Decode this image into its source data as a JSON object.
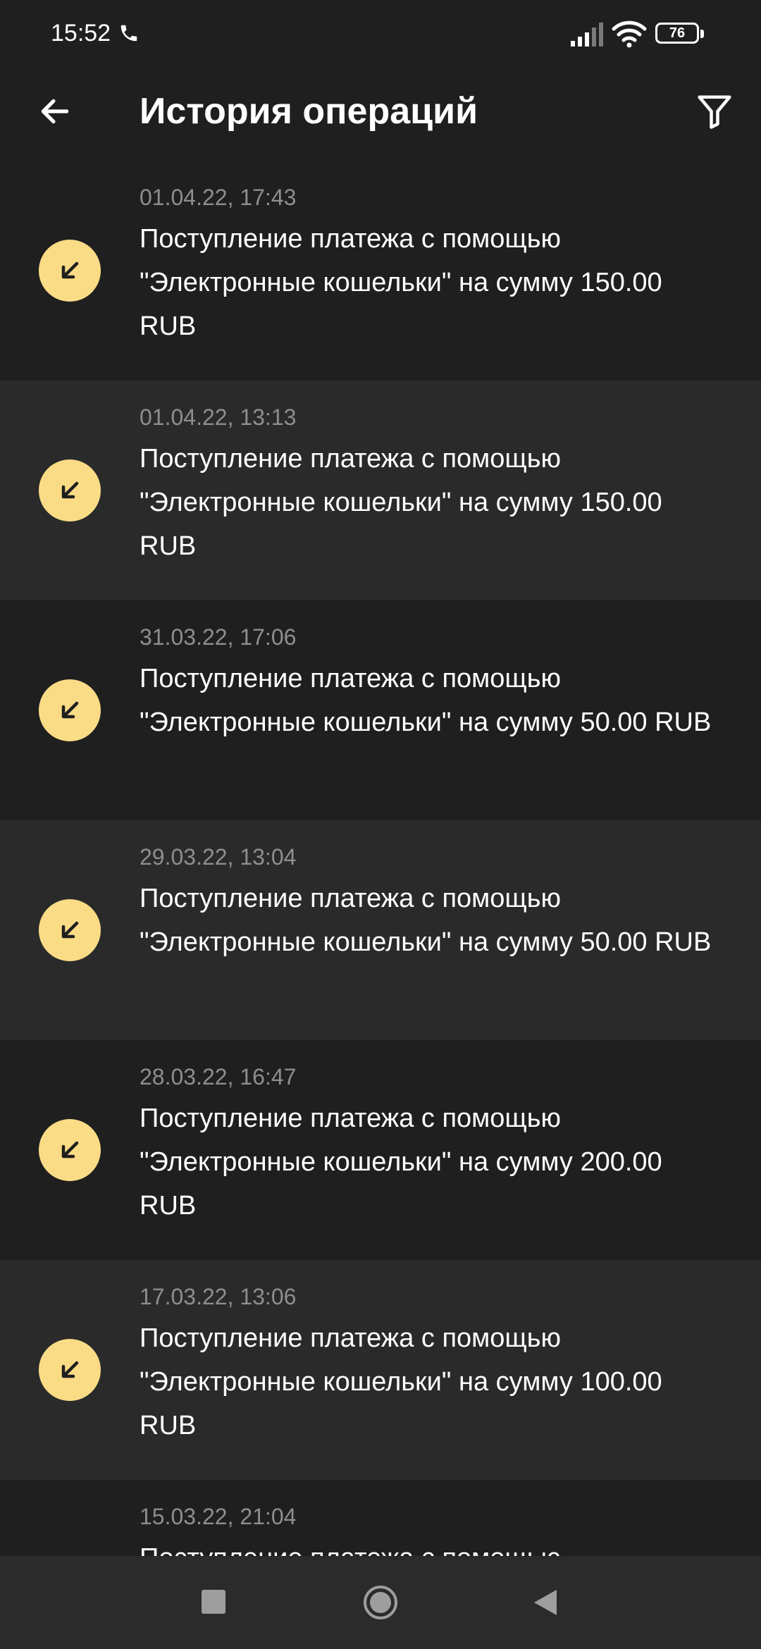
{
  "status_bar": {
    "time": "15:52",
    "battery": "76",
    "icons": [
      "phone-call-icon",
      "signal-icon",
      "wifi-icon",
      "battery-icon"
    ]
  },
  "header": {
    "title": "История операций",
    "back_icon": "arrow-left-icon",
    "filter_icon": "filter-icon"
  },
  "operations": [
    {
      "date": "01.04.22, 17:43",
      "description": "Поступление платежа с помощью \"Электронные кошельки\" на сумму 150.00 RUB"
    },
    {
      "date": "01.04.22, 13:13",
      "description": "Поступление платежа с помощью \"Электронные кошельки\" на сумму 150.00 RUB"
    },
    {
      "date": "31.03.22, 17:06",
      "description": "Поступление платежа с помощью \"Электронные кошельки\" на сумму 50.00 RUB"
    },
    {
      "date": "29.03.22, 13:04",
      "description": "Поступление платежа с помощью \"Электронные кошельки\" на сумму 50.00 RUB"
    },
    {
      "date": "28.03.22, 16:47",
      "description": "Поступление платежа с помощью \"Электронные кошельки\" на сумму 200.00 RUB"
    },
    {
      "date": "17.03.22, 13:06",
      "description": "Поступление платежа с помощью \"Электронные кошельки\" на сумму 100.00 RUB"
    },
    {
      "date": "15.03.22, 21:04",
      "description": "Поступление платежа с помощью"
    }
  ],
  "colors": {
    "background": "#1f1f1f",
    "row_alt": "#2a2a2a",
    "accent": "#fbdc86",
    "date_text": "#8e8e8e"
  },
  "nav_bar": {
    "icons": [
      "recent-apps-icon",
      "home-icon",
      "back-triangle-icon"
    ]
  }
}
